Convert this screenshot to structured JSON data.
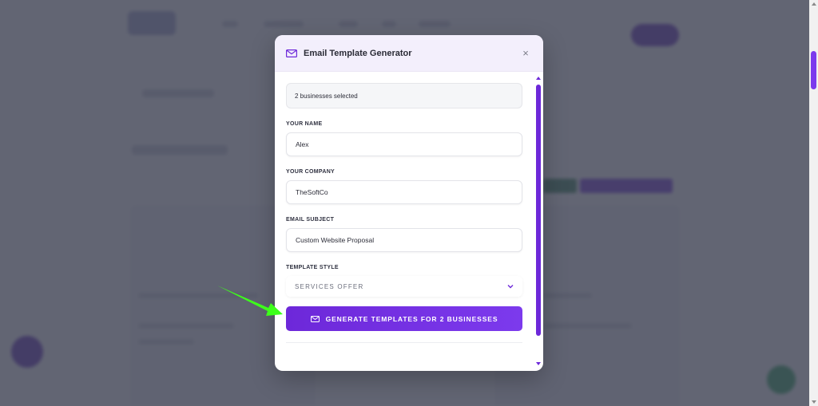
{
  "modal": {
    "title": "Email Template Generator",
    "close_label": "×",
    "selected_summary": "2 businesses selected",
    "fields": {
      "your_name": {
        "label": "YOUR NAME",
        "value": "Alex"
      },
      "your_company": {
        "label": "YOUR COMPANY",
        "value": "TheSoftCo"
      },
      "email_subject": {
        "label": "EMAIL SUBJECT",
        "value": "Custom Website Proposal"
      }
    },
    "template_style": {
      "label": "TEMPLATE STYLE",
      "selected": "SERVICES OFFER"
    },
    "generate_button": "GENERATE TEMPLATES FOR 2 BUSINESSES"
  },
  "colors": {
    "accent": "#6d28d9",
    "overlay": "#3f4354",
    "annotation_arrow": "#3dff1a"
  },
  "icons": {
    "header": "mail-icon",
    "close": "close-icon",
    "dropdown": "chevron-down-icon",
    "button": "mail-icon"
  }
}
